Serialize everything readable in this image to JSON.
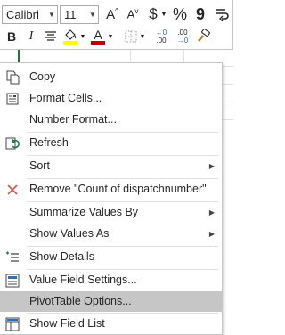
{
  "toolbar": {
    "font_name": "Calibri",
    "font_size": "11",
    "grow_font": "A",
    "shrink_font": "A",
    "currency": "$",
    "percent": "%",
    "comma": "9",
    "bold": "B",
    "italic": "I",
    "font_color_letter": "A",
    "decrease_decimal_top": "←0",
    "decrease_decimal_bottom": ".00",
    "increase_decimal_top": ".00",
    "increase_decimal_bottom": "→0",
    "colors": {
      "highlight": "#ffff00",
      "font": "#c00000",
      "accent": "#217346"
    }
  },
  "menu": {
    "items": [
      {
        "label": "Copy",
        "icon": "copy-icon"
      },
      {
        "label": "Format Cells...",
        "icon": "format-cells-icon"
      },
      {
        "label": "Number Format...",
        "icon": ""
      },
      {
        "label": "Refresh",
        "icon": "refresh-icon"
      },
      {
        "label": "Sort",
        "icon": ""
      },
      {
        "label": "Remove \"Count of dispatchnumber\"",
        "icon": "remove-icon"
      },
      {
        "label": "Summarize Values By",
        "icon": ""
      },
      {
        "label": "Show Values As",
        "icon": ""
      },
      {
        "label": "Show Details",
        "icon": "show-details-icon"
      },
      {
        "label": "Value Field Settings...",
        "icon": "value-field-settings-icon"
      },
      {
        "label": "PivotTable Options...",
        "icon": ""
      },
      {
        "label": "Show Field List",
        "icon": "field-list-icon"
      }
    ],
    "highlighted": "PivotTable Options..."
  }
}
